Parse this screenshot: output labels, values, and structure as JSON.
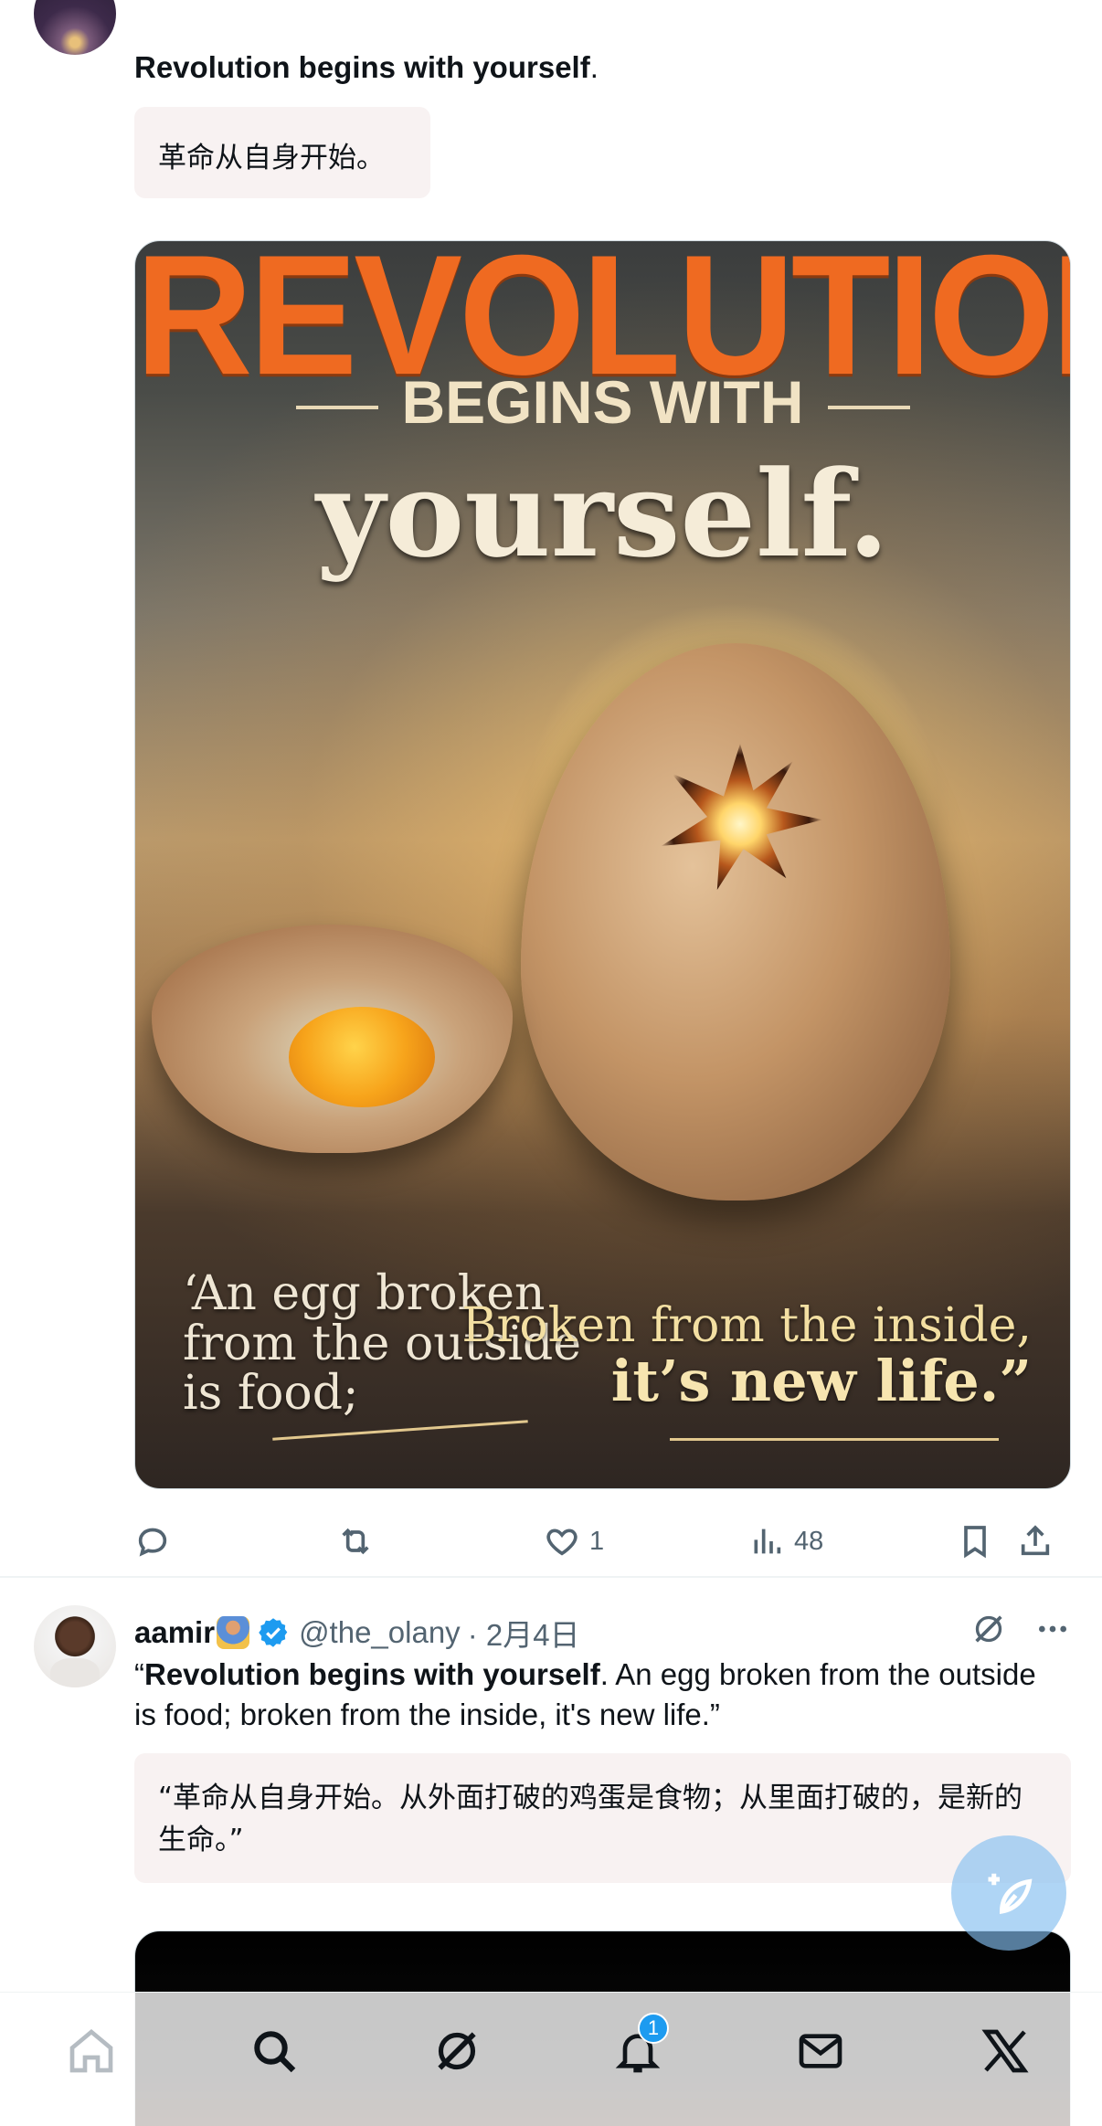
{
  "tweet1": {
    "title_bold": "Revolution begins with yourself",
    "title_dot": ".",
    "translation": "革命从自身开始。",
    "image": {
      "line1": "REVOLUTION",
      "line2": "BEGINS WITH",
      "line3": "yourself.",
      "quote_left": [
        "‘An egg broken",
        "from the outside",
        "is food;"
      ],
      "quote_right": [
        "Broken from the inside,",
        "it’s new life.”"
      ]
    },
    "actions": {
      "reply_count": "",
      "repost_count": "",
      "like_count": "1",
      "views_count": "48"
    }
  },
  "tweet2": {
    "name": "aamir",
    "handle": "@the_olany",
    "date": "· 2月4日",
    "text_open": "“",
    "text_bold": "Revolution begins with yourself",
    "text_rest": ". An egg broken from the outside is food; broken from the inside, it's new life.”",
    "translation": "“革命从自身开始。从外面打破的鸡蛋是食物；从里面打破的，是新的生命。”"
  },
  "nav": {
    "notifications_badge": "1"
  },
  "colors": {
    "accent": "#1d9bf0",
    "muted": "#536471",
    "translation_bg": "#f8f2f2"
  }
}
